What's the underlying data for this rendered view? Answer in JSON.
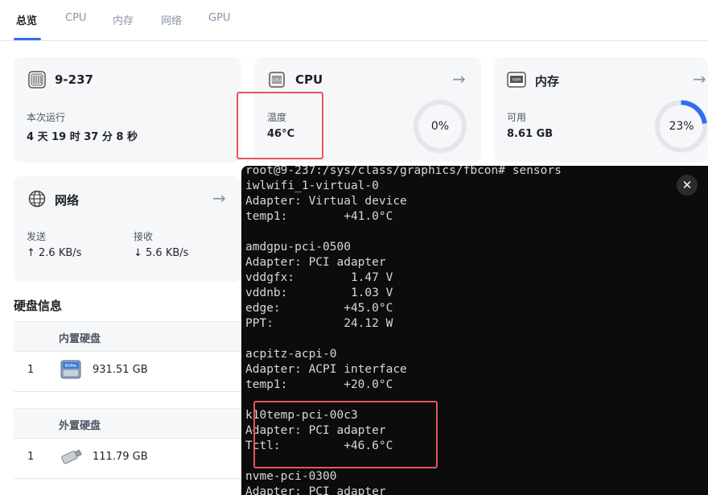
{
  "tabs": [
    "总览",
    "CPU",
    "内存",
    "网络",
    "GPU"
  ],
  "system": {
    "hostname": "9-237",
    "uptime_label": "本次运行",
    "uptime_value": "4 天 19 时 37 分 8 秒"
  },
  "cpu": {
    "title": "CPU",
    "temp_label": "温度",
    "temp_value": "46°C",
    "usage_text": "0%",
    "usage_fraction": 0
  },
  "memory": {
    "title": "内存",
    "used_label": "可用",
    "used_value": "8.61 GB",
    "usage_text": "23%",
    "usage_fraction": 0.23
  },
  "network": {
    "title": "网络",
    "send_label": "发送",
    "send_value": "↑ 2.6 KB/s",
    "recv_label": "接收",
    "recv_value": "↓ 5.6 KB/s"
  },
  "disks": {
    "title": "硬盘信息",
    "internal_header": "内置硬盘",
    "internal": [
      {
        "index": "1",
        "size": "931.51 GB",
        "icon": "nvme-disk-icon"
      }
    ],
    "external_header": "外置硬盘",
    "external": [
      {
        "index": "1",
        "size": "111.79 GB",
        "icon": "usb-drive-icon"
      }
    ]
  },
  "terminal": {
    "lines": [
      "root@9-237:/sys/class/graphics/fbcon# sensors",
      "iwlwifi_1-virtual-0",
      "Adapter: Virtual device",
      "temp1:        +41.0°C",
      "",
      "amdgpu-pci-0500",
      "Adapter: PCI adapter",
      "vddgfx:        1.47 V",
      "vddnb:         1.03 V",
      "edge:         +45.0°C",
      "PPT:          24.12 W",
      "",
      "acpitz-acpi-0",
      "Adapter: ACPI interface",
      "temp1:        +20.0°C",
      "",
      "k10temp-pci-00c3",
      "Adapter: PCI adapter",
      "Tctl:         +46.6°C",
      "",
      "nvme-pci-0300",
      "Adapter: PCI adapter"
    ],
    "close_glyph": "✕"
  },
  "colors": {
    "accent": "#2f6fed",
    "highlight": "#e2575a",
    "terminal_bg": "#0c0c0c"
  }
}
